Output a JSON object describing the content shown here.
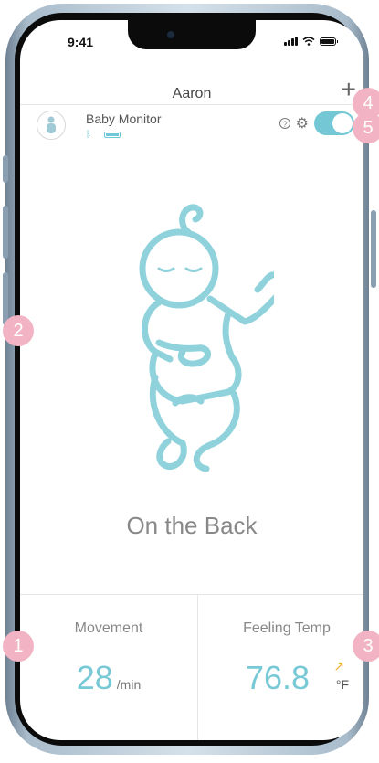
{
  "status": {
    "time": "9:41"
  },
  "header": {
    "title": "Aaron",
    "add_glyph": "+"
  },
  "device": {
    "name": "Baby Monitor",
    "bluetooth_glyph": "ᛒ",
    "help_glyph": "?",
    "settings_glyph": "⚙",
    "toggle_on": true
  },
  "main": {
    "position_text": "On the Back"
  },
  "stats": {
    "movement": {
      "label": "Movement",
      "value": "28",
      "unit": "/min"
    },
    "temp": {
      "label": "Feeling Temp",
      "value": "76.8",
      "unit": "°F",
      "trend_glyph": "↗"
    }
  },
  "badges": [
    "1",
    "2",
    "3",
    "4",
    "5"
  ],
  "colors": {
    "accent": "#78c9d6",
    "badge": "#f2b4c4",
    "trend": "#f0b233"
  }
}
